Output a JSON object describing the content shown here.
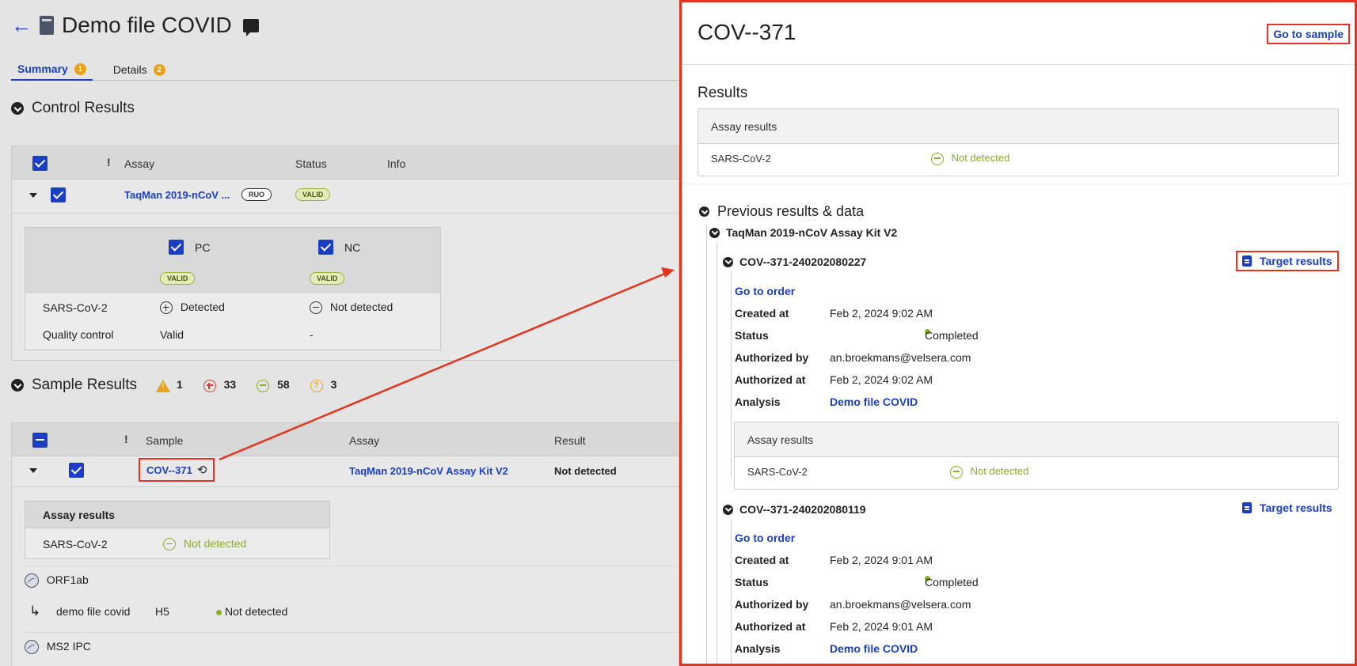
{
  "header": {
    "title": "Demo file COVID"
  },
  "tabs": [
    {
      "label": "Summary",
      "badge": "1"
    },
    {
      "label": "Details",
      "badge": "2"
    }
  ],
  "control": {
    "title": "Control Results",
    "columns": {
      "assay": "Assay",
      "status": "Status",
      "info": "Info",
      "flag": "!"
    },
    "row": {
      "assay": "TaqMan 2019-nCoV ...",
      "tag": "RUO",
      "status": "VALID"
    },
    "controls": [
      {
        "name": "PC",
        "status": "VALID",
        "result": "Detected",
        "qc": "Valid"
      },
      {
        "name": "NC",
        "status": "VALID",
        "result": "Not detected",
        "qc": "-"
      }
    ],
    "target_label": "SARS-CoV-2",
    "qc_label": "Quality control"
  },
  "sample": {
    "title": "Sample Results",
    "counts": {
      "warning": "1",
      "detected": "33",
      "not_detected": "58",
      "unknown": "3"
    },
    "columns": {
      "flag": "!",
      "sample": "Sample",
      "assay": "Assay",
      "result": "Result"
    },
    "row": {
      "sample": "COV--371",
      "assay": "TaqMan 2019-nCoV Assay Kit V2",
      "result": "Not detected"
    },
    "assay_results": {
      "header": "Assay results",
      "target": "SARS-CoV-2",
      "result": "Not detected"
    },
    "targets": [
      {
        "name": "ORF1ab",
        "sub": {
          "file": "demo file covid",
          "well": "H5",
          "result": "Not detected"
        }
      },
      {
        "name": "MS2 IPC"
      }
    ]
  },
  "panel": {
    "title": "COV--371",
    "go_to_sample": "Go to sample",
    "results_title": "Results",
    "assay_results": {
      "header": "Assay results",
      "target": "SARS-CoV-2",
      "result": "Not detected"
    },
    "previous_title": "Previous results & data",
    "kit": "TaqMan 2019-nCoV Assay Kit V2",
    "runs": [
      {
        "id": "COV--371-240202080227",
        "target_results": "Target results",
        "go_to_order": "Go to order",
        "fields": [
          {
            "label": "Created at",
            "value": "Feb 2, 2024 9:02 AM"
          },
          {
            "label": "Status",
            "value": "Completed"
          },
          {
            "label": "Authorized by",
            "value": "an.broekmans@velsera.com"
          },
          {
            "label": "Authorized at",
            "value": "Feb 2, 2024 9:02 AM"
          },
          {
            "label": "Analysis",
            "value": "Demo file COVID"
          }
        ],
        "assay_results": {
          "header": "Assay results",
          "target": "SARS-CoV-2",
          "result": "Not detected"
        }
      },
      {
        "id": "COV--371-240202080119",
        "target_results": "Target results",
        "go_to_order": "Go to order",
        "fields": [
          {
            "label": "Created at",
            "value": "Feb 2, 2024 9:01 AM"
          },
          {
            "label": "Status",
            "value": "Completed"
          },
          {
            "label": "Authorized by",
            "value": "an.broekmans@velsera.com"
          },
          {
            "label": "Authorized at",
            "value": "Feb 2, 2024 9:01 AM"
          },
          {
            "label": "Analysis",
            "value": "Demo file COVID"
          }
        ]
      }
    ]
  },
  "colors": {
    "accent": "#1a3fc4",
    "highlight": "#e6321e",
    "negative": "#8ab020",
    "warning": "#e8a21a",
    "positive": "#d63a2e"
  },
  "icons": [
    "back-arrow-icon",
    "file-icon",
    "comment-icon",
    "chevron-down-icon",
    "history-icon",
    "warning-icon",
    "plus-circle-icon",
    "minus-circle-icon",
    "question-circle-icon",
    "waveform-icon",
    "clipboard-icon",
    "subdirectory-arrow-icon"
  ]
}
